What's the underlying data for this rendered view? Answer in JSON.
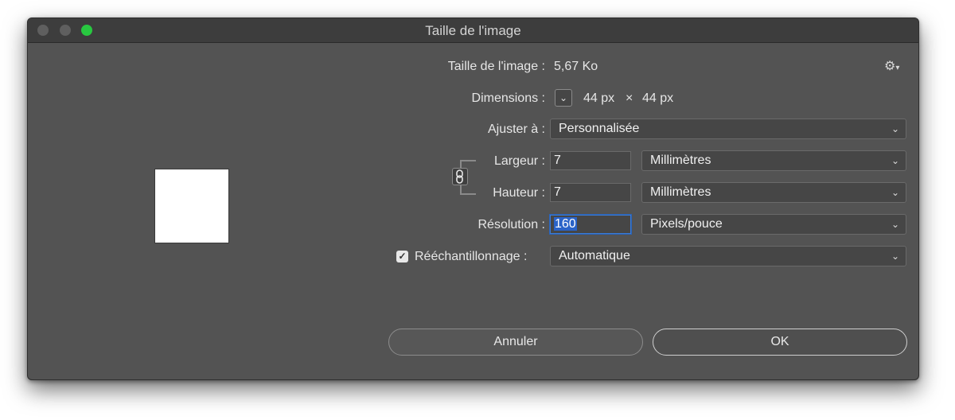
{
  "window": {
    "title": "Taille de l'image"
  },
  "info": {
    "size_label": "Taille de l'image :",
    "size_value": "5,67 Ko",
    "dimensions_label": "Dimensions :",
    "dim_width": "44 px",
    "dim_times": "×",
    "dim_height": "44 px"
  },
  "fit": {
    "label": "Ajuster à :",
    "value": "Personnalisée"
  },
  "width": {
    "label": "Largeur :",
    "value": "7",
    "unit": "Millimètres"
  },
  "height": {
    "label": "Hauteur :",
    "value": "7",
    "unit": "Millimètres"
  },
  "resolution": {
    "label": "Résolution :",
    "value": "160",
    "unit": "Pixels/pouce"
  },
  "resample": {
    "label": "Rééchantillonnage :",
    "checked": true,
    "value": "Automatique"
  },
  "buttons": {
    "cancel": "Annuler",
    "ok": "OK"
  },
  "icons": {
    "gear": "gear-icon",
    "chain": "link-chain-icon",
    "chevron": "chevron-down-icon"
  },
  "colors": {
    "dialog_bg": "#535353",
    "accent": "#2a63c8",
    "zoom_green": "#28c840"
  }
}
